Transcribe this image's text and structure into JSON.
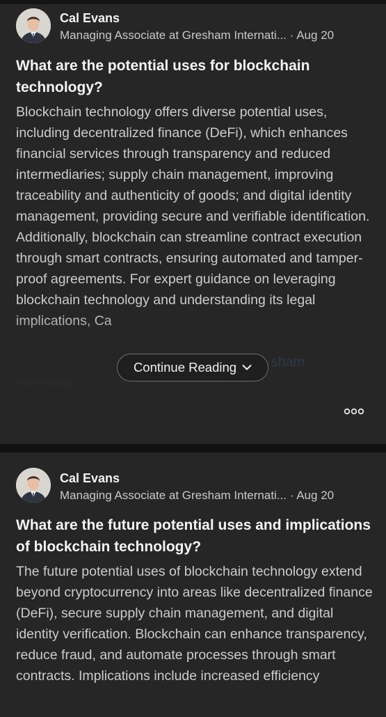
{
  "posts": [
    {
      "author": "Cal Evans",
      "headline": "Managing Associate at Gresham Internati...",
      "separator": "·",
      "date": "Aug 20",
      "title": "What are the potential uses for blockchain technology?",
      "body": "Blockchain technology offers diverse potential uses, including decentralized finance (DeFi), which enhances financial services through transparency and reduced intermediaries; supply chain management, improving traceability and authenticity of goods; and digital identity management, providing secure and verifiable identification. Additionally, blockchain can streamline contract execution through smart contracts, ensuring automated and tamper-proof agreements. For expert guidance on leveraging blockchain technology and understanding its legal implications, Ca",
      "link_fragment_1": "sham",
      "link_fragment_2": "Internatio",
      "continue_label": "Continue Reading",
      "continue_icon": "chevron-down-icon",
      "more_icon": "more-options-icon"
    },
    {
      "author": "Cal Evans",
      "headline": "Managing Associate at Gresham Internati...",
      "separator": "·",
      "date": "Aug 20",
      "title": "What are the future potential uses and implications of blockchain technology?",
      "body": "The future potential uses of blockchain technology extend beyond cryptocurrency into areas like decentralized finance (DeFi), secure supply chain management, and digital identity verification. Blockchain can enhance transparency, reduce fraud, and automate processes through smart contracts. Implications include increased efficiency"
    }
  ],
  "colors": {
    "background": "#1b1b1b",
    "card": "#262626",
    "link": "#4a8bd6",
    "text": "#cccccc"
  }
}
